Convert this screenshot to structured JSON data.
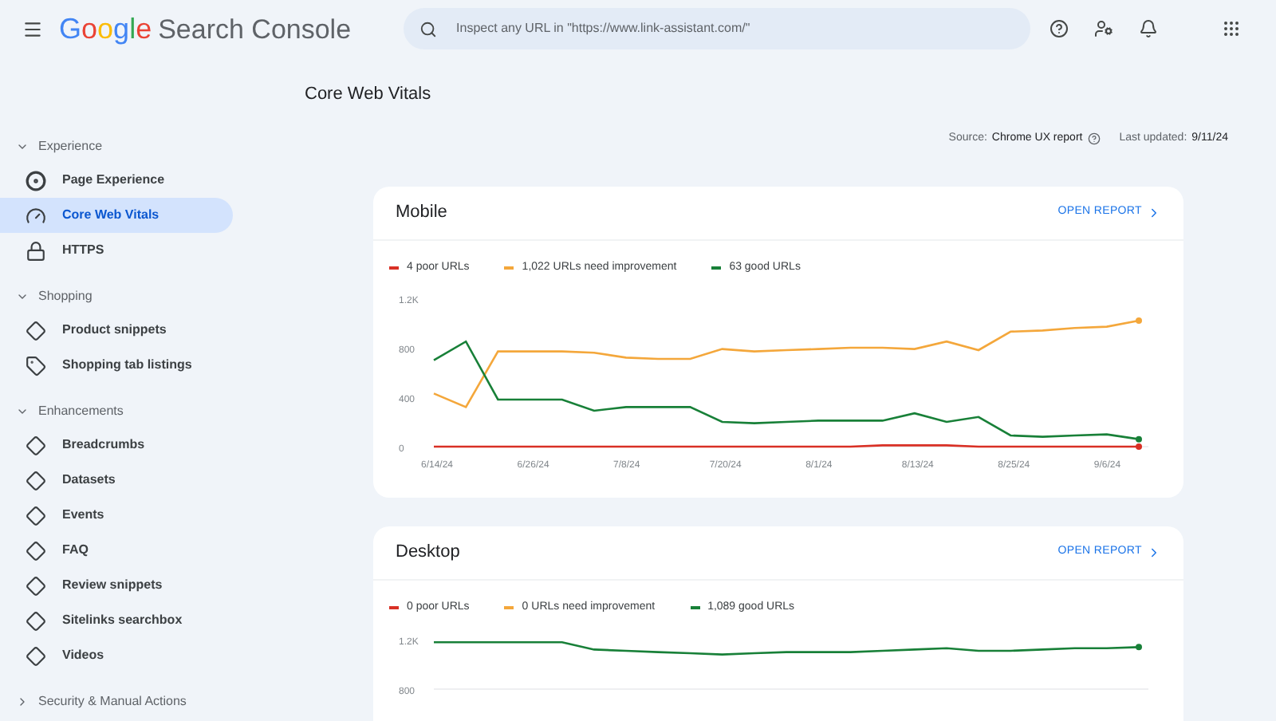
{
  "header": {
    "logo": {
      "brand": "Google",
      "product": "Search Console"
    },
    "search": {
      "placeholder": "Inspect any URL in \"https://www.link-assistant.com/\""
    }
  },
  "sidebar": {
    "sections": [
      {
        "title": "Experience",
        "expanded": true,
        "items": [
          {
            "label": "Page Experience",
            "selected": false
          },
          {
            "label": "Core Web Vitals",
            "selected": true
          },
          {
            "label": "HTTPS",
            "selected": false
          }
        ]
      },
      {
        "title": "Shopping",
        "expanded": true,
        "items": [
          {
            "label": "Product snippets",
            "selected": false
          },
          {
            "label": "Shopping tab listings",
            "selected": false
          }
        ]
      },
      {
        "title": "Enhancements",
        "expanded": true,
        "items": [
          {
            "label": "Breadcrumbs",
            "selected": false
          },
          {
            "label": "Datasets",
            "selected": false
          },
          {
            "label": "Events",
            "selected": false
          },
          {
            "label": "FAQ",
            "selected": false
          },
          {
            "label": "Review snippets",
            "selected": false
          },
          {
            "label": "Sitelinks searchbox",
            "selected": false
          },
          {
            "label": "Videos",
            "selected": false
          }
        ]
      },
      {
        "title": "Security & Manual Actions",
        "expanded": false
      }
    ]
  },
  "page": {
    "title": "Core Web Vitals",
    "source_label": "Source:",
    "source": "Chrome UX report",
    "updated_label": "Last updated:",
    "updated": "9/11/24"
  },
  "reports": [
    {
      "title": "Mobile",
      "link": "OPEN REPORT",
      "chart_data": {
        "type": "line",
        "categories": [
          "6/14/24",
          null,
          null,
          "6/26/24",
          null,
          null,
          "7/8/24",
          null,
          null,
          "7/20/24",
          null,
          null,
          "8/1/24",
          null,
          null,
          "8/13/24",
          null,
          null,
          "8/25/24",
          null,
          null,
          "9/6/24",
          null
        ],
        "ylim": [
          0,
          1200
        ],
        "yticks": [
          0,
          400,
          800,
          {
            "value": 1200,
            "label": "1.2K"
          }
        ],
        "series": [
          {
            "name": "4 poor URLs",
            "color": "#d93025",
            "values": [
              0,
              0,
              0,
              0,
              0,
              0,
              0,
              0,
              0,
              0,
              0,
              0,
              0,
              0,
              10,
              10,
              10,
              0,
              0,
              0,
              0,
              0,
              0
            ]
          },
          {
            "name": "1,022 URLs need improvement",
            "color": "#f4a73b",
            "values": [
              430,
              320,
              770,
              770,
              770,
              760,
              720,
              710,
              710,
              790,
              770,
              780,
              790,
              800,
              800,
              790,
              850,
              780,
              930,
              940,
              960,
              970,
              1020
            ]
          },
          {
            "name": "63 good URLs",
            "color": "#188038",
            "values": [
              700,
              850,
              380,
              380,
              380,
              290,
              320,
              320,
              320,
              200,
              190,
              200,
              210,
              210,
              210,
              270,
              200,
              240,
              90,
              80,
              90,
              100,
              60
            ]
          }
        ]
      }
    },
    {
      "title": "Desktop",
      "link": "OPEN REPORT",
      "chart_data": {
        "type": "line",
        "categories": [
          null,
          null,
          null,
          null,
          null,
          null,
          null,
          null,
          null,
          null,
          null,
          null,
          null,
          null,
          null,
          null,
          null,
          null,
          null,
          null,
          null,
          null,
          null
        ],
        "ylim": [
          800,
          1200
        ],
        "yticks": [
          800,
          {
            "value": 1200,
            "label": "1.2K"
          }
        ],
        "series": [
          {
            "name": "0 poor URLs",
            "color": "#d93025",
            "values": [
              null,
              null,
              null,
              null,
              null,
              null,
              null,
              null,
              null,
              null,
              null,
              null,
              null,
              null,
              null,
              null,
              null,
              null,
              null,
              null,
              null,
              null,
              null
            ]
          },
          {
            "name": "0 URLs need improvement",
            "color": "#f4a73b",
            "values": [
              null,
              null,
              null,
              null,
              null,
              null,
              null,
              null,
              null,
              null,
              null,
              null,
              null,
              null,
              null,
              null,
              null,
              null,
              null,
              null,
              null,
              null,
              null
            ]
          },
          {
            "name": "1,089 good URLs",
            "color": "#188038",
            "values": [
              1180,
              1180,
              1180,
              1180,
              1180,
              1120,
              1110,
              1100,
              1090,
              1080,
              1090,
              1100,
              1100,
              1100,
              1110,
              1120,
              1130,
              1110,
              1110,
              1120,
              1130,
              1130,
              1140
            ]
          }
        ]
      }
    }
  ]
}
